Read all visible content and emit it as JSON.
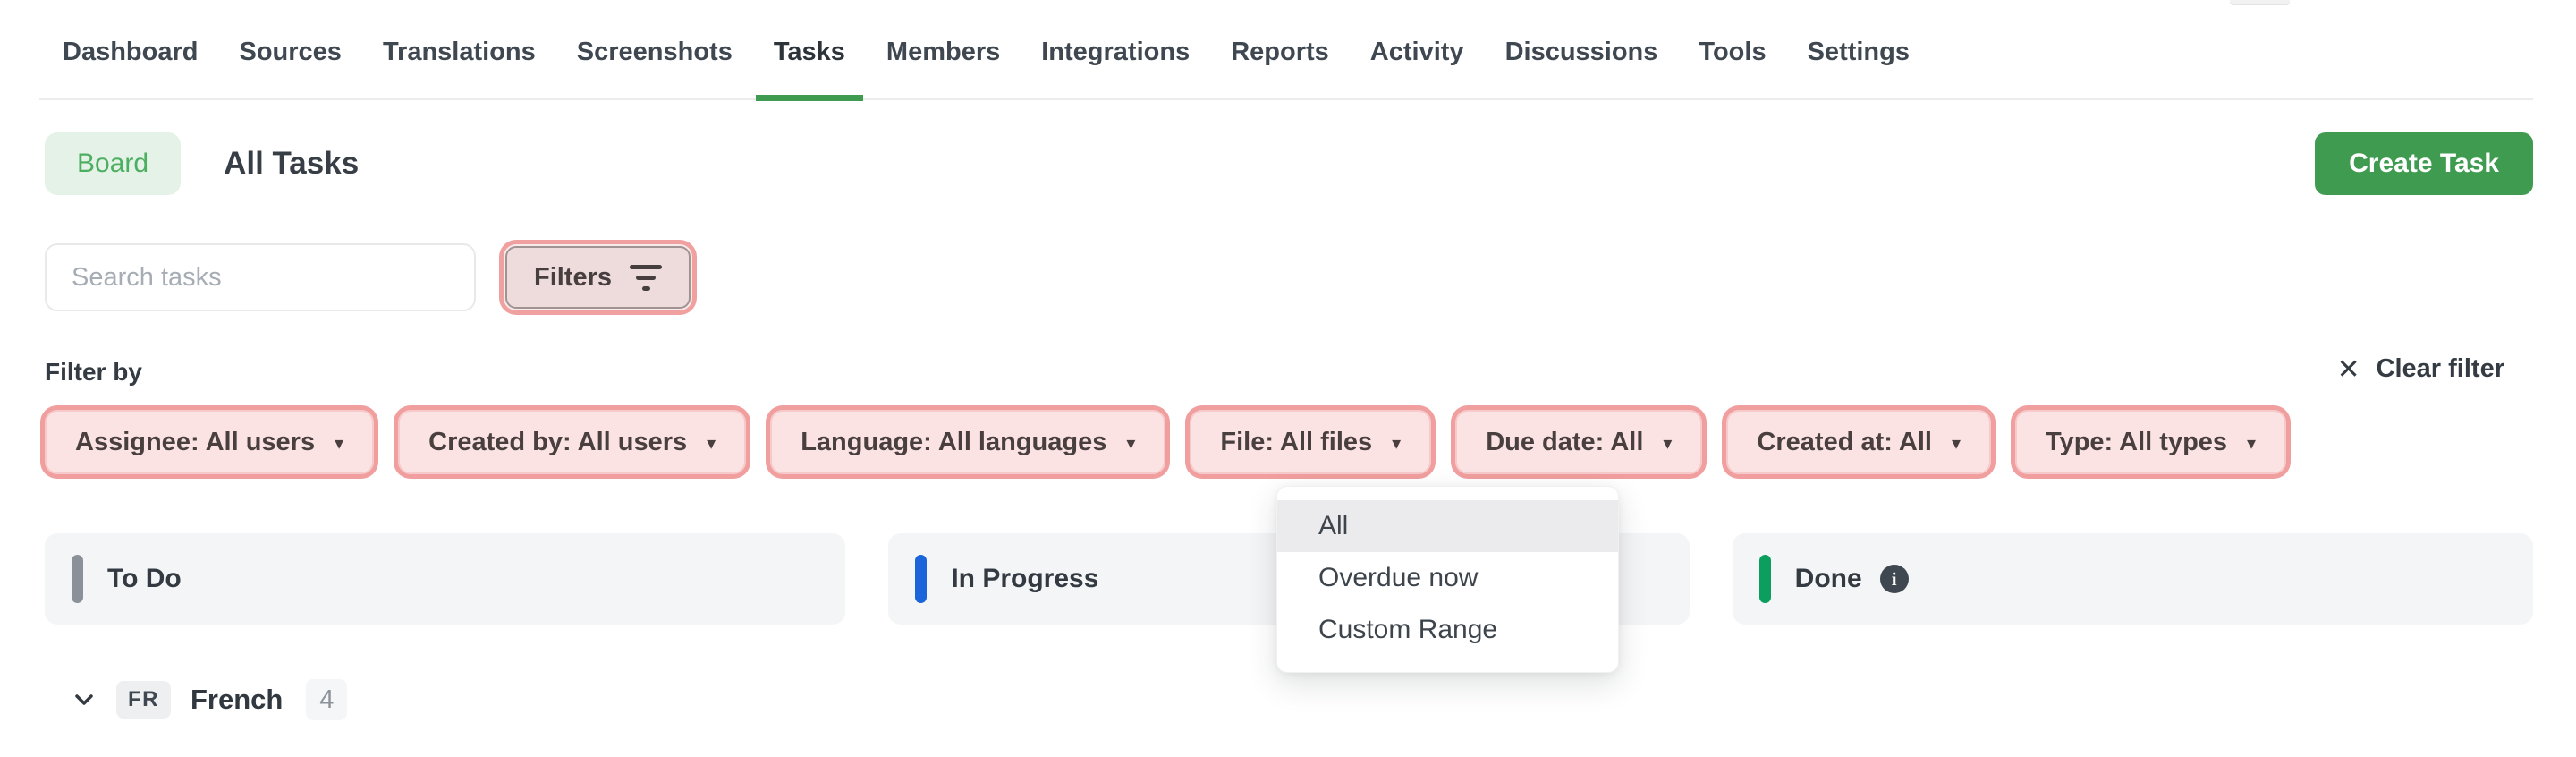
{
  "nav": {
    "items": [
      {
        "label": "Dashboard"
      },
      {
        "label": "Sources"
      },
      {
        "label": "Translations"
      },
      {
        "label": "Screenshots"
      },
      {
        "label": "Tasks",
        "active": true
      },
      {
        "label": "Members"
      },
      {
        "label": "Integrations"
      },
      {
        "label": "Reports"
      },
      {
        "label": "Activity"
      },
      {
        "label": "Discussions"
      },
      {
        "label": "Tools"
      },
      {
        "label": "Settings"
      }
    ]
  },
  "toolbar": {
    "board_label": "Board",
    "page_title": "All Tasks",
    "create_task_label": "Create Task"
  },
  "search": {
    "placeholder": "Search tasks",
    "value": ""
  },
  "filters_button": {
    "label": "Filters"
  },
  "filter_bar": {
    "label": "Filter by",
    "clear_label": "Clear filter",
    "chips": [
      {
        "label": "Assignee: All users"
      },
      {
        "label": "Created by: All users"
      },
      {
        "label": "Language: All languages"
      },
      {
        "label": "File: All files"
      },
      {
        "label": "Due date: All"
      },
      {
        "label": "Created at: All"
      },
      {
        "label": "Type: All types"
      }
    ]
  },
  "due_date_menu": {
    "items": [
      {
        "label": "All",
        "highlighted": true
      },
      {
        "label": "Overdue now"
      },
      {
        "label": "Custom Range"
      }
    ]
  },
  "board": {
    "columns": [
      {
        "label": "To Do",
        "color": "#8b9198"
      },
      {
        "label": "In Progress",
        "color": "#1b64d9"
      },
      {
        "label": "Done",
        "color": "#0b9e5f",
        "has_info": true
      }
    ]
  },
  "groups": [
    {
      "code": "FR",
      "name": "French",
      "count": "4"
    }
  ],
  "icons": {
    "caret": "▾",
    "close": "✕",
    "info": "i"
  },
  "colors": {
    "accent_green": "#3f9b4f",
    "chip_ring": "#f09e9e",
    "chip_fill": "#fbe3e3"
  }
}
